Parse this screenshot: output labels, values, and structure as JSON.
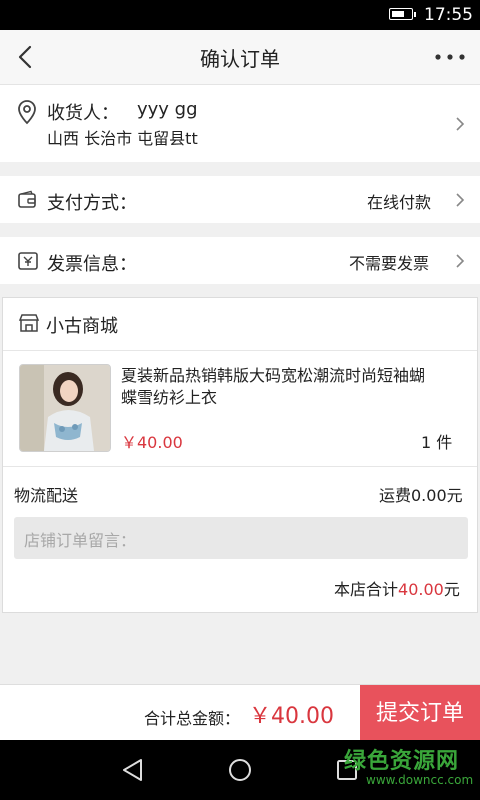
{
  "status_bar": {
    "time": "17:55",
    "battery_level": 0.55
  },
  "header": {
    "title": "确认订单"
  },
  "address": {
    "recipient_label": "收货人：",
    "recipient_name": "yyy  gg",
    "address": "山西 长治市 屯留县tt"
  },
  "payment": {
    "label": "支付方式：",
    "value": "在线付款"
  },
  "invoice": {
    "label": "发票信息：",
    "value": "不需要发票"
  },
  "store": {
    "name": "小古商城",
    "product": {
      "title_line1": "夏装新品热销韩版大码宽松潮流时尚短袖蝴",
      "title_line2": "蝶雪纺衫上衣",
      "price": "￥40.00",
      "quantity": "1 件"
    },
    "shipping_label": "物流配送",
    "shipping_fee": "运费0.00元",
    "note_placeholder": "店铺订单留言：",
    "subtotal_label": "本店合计",
    "subtotal_value": "40.00",
    "subtotal_unit": "元"
  },
  "bottom": {
    "total_label": "合计总金额：",
    "total_value": "￥40.00",
    "submit_label": "提交订单"
  },
  "watermark": {
    "line1": "绿色资源网",
    "line2": "www.downcc.com"
  },
  "colors": {
    "accent": "#e8525c",
    "price": "#d9363e"
  },
  "icons": [
    "battery-icon",
    "back-arrow-icon",
    "more-dots-icon",
    "location-pin-icon",
    "wallet-icon",
    "invoice-icon",
    "store-icon",
    "chevron-right-icon",
    "nav-back-icon",
    "nav-home-icon",
    "nav-recents-icon"
  ]
}
